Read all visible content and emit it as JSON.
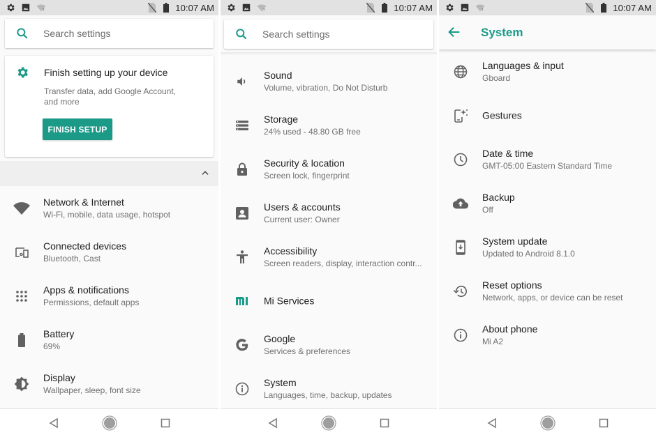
{
  "colors": {
    "accent": "#1b9a88",
    "icon": "#616161",
    "status_bar": "#e2e2e2",
    "background": "#fafafa"
  },
  "status_bar": {
    "time": "10:07 AM",
    "left_icons": [
      "settings-gear-icon",
      "image-icon",
      "wifi-unknown-icon"
    ],
    "right_icons": [
      "no-sim-icon",
      "battery-icon"
    ]
  },
  "panels": [
    {
      "search": {
        "placeholder": "Search settings"
      },
      "setup_card": {
        "title": "Finish setting up your device",
        "description": "Transfer data, add Google Account, and more",
        "button_label": "FINISH SETUP"
      },
      "items": [
        {
          "icon": "wifi-icon",
          "title": "Network & Internet",
          "subtitle": "Wi-Fi, mobile, data usage, hotspot"
        },
        {
          "icon": "connected-devices-icon",
          "title": "Connected devices",
          "subtitle": "Bluetooth, Cast"
        },
        {
          "icon": "apps-grid-icon",
          "title": "Apps & notifications",
          "subtitle": "Permissions, default apps"
        },
        {
          "icon": "battery-icon",
          "title": "Battery",
          "subtitle": "69%"
        },
        {
          "icon": "brightness-icon",
          "title": "Display",
          "subtitle": "Wallpaper, sleep, font size"
        }
      ]
    },
    {
      "search": {
        "placeholder": "Search settings"
      },
      "items": [
        {
          "icon": "volume-icon",
          "title": "Sound",
          "subtitle": "Volume, vibration, Do Not Disturb"
        },
        {
          "icon": "storage-icon",
          "title": "Storage",
          "subtitle": "24% used - 48.80 GB free"
        },
        {
          "icon": "lock-icon",
          "title": "Security & location",
          "subtitle": "Screen lock, fingerprint"
        },
        {
          "icon": "account-box-icon",
          "title": "Users & accounts",
          "subtitle": "Current user: Owner"
        },
        {
          "icon": "accessibility-icon",
          "title": "Accessibility",
          "subtitle": "Screen readers, display, interaction contr..."
        },
        {
          "icon": "mi-logo-icon",
          "title": "Mi Services",
          "subtitle": ""
        },
        {
          "icon": "google-g-icon",
          "title": "Google",
          "subtitle": "Services & preferences"
        },
        {
          "icon": "info-icon",
          "title": "System",
          "subtitle": "Languages, time, backup, updates"
        }
      ]
    },
    {
      "toolbar": {
        "title": "System"
      },
      "items": [
        {
          "icon": "globe-icon",
          "title": "Languages & input",
          "subtitle": "Gboard"
        },
        {
          "icon": "gestures-icon",
          "title": "Gestures",
          "subtitle": ""
        },
        {
          "icon": "clock-icon",
          "title": "Date & time",
          "subtitle": "GMT-05:00 Eastern Standard Time"
        },
        {
          "icon": "cloud-upload-icon",
          "title": "Backup",
          "subtitle": "Off"
        },
        {
          "icon": "system-update-icon",
          "title": "System update",
          "subtitle": "Updated to Android 8.1.0"
        },
        {
          "icon": "restore-icon",
          "title": "Reset options",
          "subtitle": "Network, apps, or device can be reset"
        },
        {
          "icon": "info-icon",
          "title": "About phone",
          "subtitle": "Mi A2"
        }
      ]
    }
  ],
  "navbar": {
    "buttons": [
      "back-icon",
      "home-icon",
      "recents-icon"
    ]
  }
}
